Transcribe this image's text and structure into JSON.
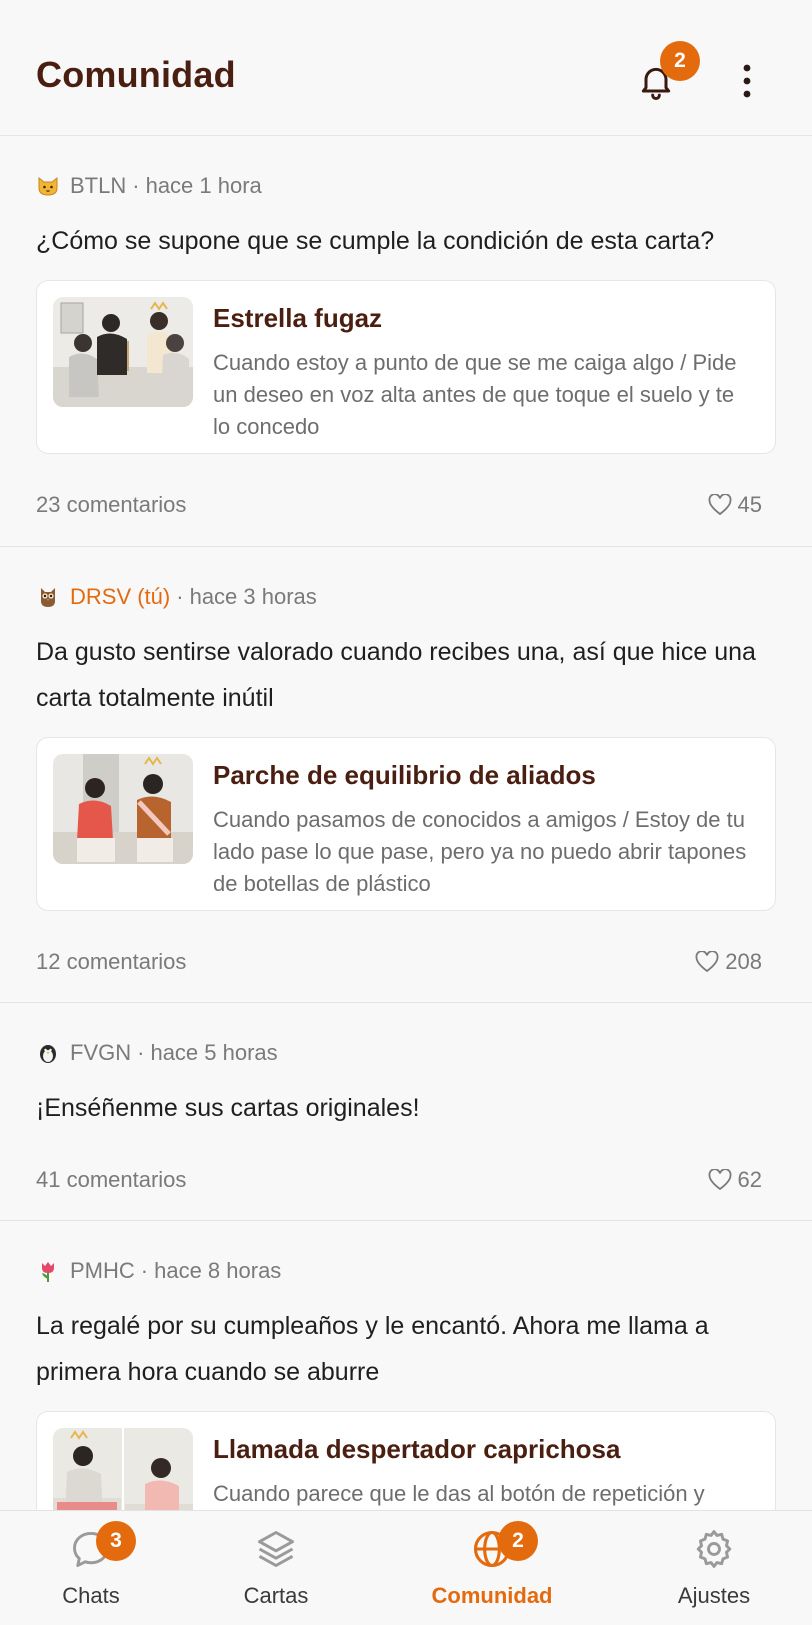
{
  "header": {
    "title": "Comunidad",
    "notification_count": "2"
  },
  "colors": {
    "accent": "#e46a0e",
    "title_brown": "#4a1f12",
    "background": "#f8f8f8"
  },
  "posts": [
    {
      "avatar_icon": "cat-face-icon",
      "author": "BTLN",
      "time": "hace 1 hora",
      "text": "¿Cómo se supone que se cumple la condición de esta carta?",
      "card": {
        "title": "Estrella fugaz",
        "description": "Cuando estoy a punto de que se me caiga algo / Pide un deseo en voz alta antes de que toque el suelo y te lo concedo"
      },
      "comments": "23 comentarios",
      "likes": "45"
    },
    {
      "avatar_icon": "owl-icon",
      "author": "DRSV (tú)",
      "time": "hace 3 horas",
      "text": "Da gusto sentirse valorado cuando recibes una, así que hice una carta totalmente inútil",
      "card": {
        "title": "Parche de equilibrio de aliados",
        "description": "Cuando pasamos de conocidos a amigos / Estoy de tu lado pase lo que pase, pero ya no puedo abrir tapones de botellas de plástico"
      },
      "comments": "12 comentarios",
      "likes": "208"
    },
    {
      "avatar_icon": "penguin-icon",
      "author": "FVGN",
      "time": "hace 5 horas",
      "text": "¡Enséñenme sus cartas originales!",
      "comments": "41 comentarios",
      "likes": "62"
    },
    {
      "avatar_icon": "tulip-icon",
      "author": "PMHC",
      "time": "hace 8 horas",
      "text": "La regalé por su cumpleaños y le encantó. Ahora me llama a primera hora cuando se aburre",
      "card": {
        "title": "Llamada despertador caprichosa",
        "description": "Cuando parece que le das al botón de repetición y"
      }
    }
  ],
  "tabs": [
    {
      "label": "Chats",
      "icon": "chat-bubble-icon",
      "badge": "3"
    },
    {
      "label": "Cartas",
      "icon": "layers-icon"
    },
    {
      "label": "Comunidad",
      "icon": "globe-icon",
      "badge": "2",
      "active": true
    },
    {
      "label": "Ajustes",
      "icon": "gear-icon"
    }
  ]
}
